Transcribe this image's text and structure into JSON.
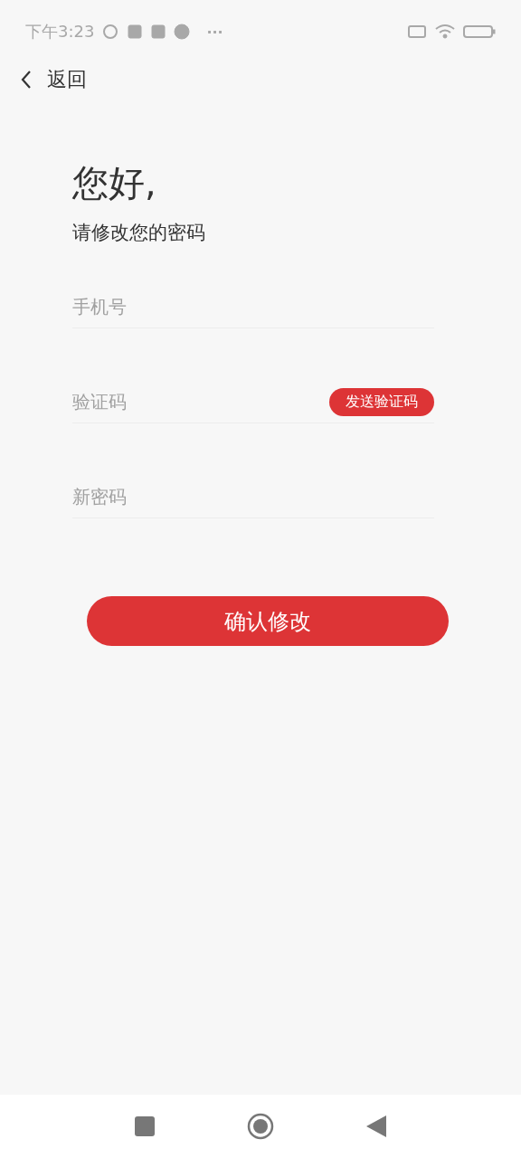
{
  "status_bar": {
    "time": "下午3:23",
    "more": "···"
  },
  "nav": {
    "back_label": "返回"
  },
  "greeting": "您好,",
  "subtitle": "请修改您的密码",
  "fields": [
    {
      "kind": "plain",
      "placeholder": "手机号"
    },
    {
      "kind": "code",
      "placeholder": "验证码",
      "button": "发送验证码"
    },
    {
      "kind": "plain",
      "placeholder": "新密码"
    }
  ],
  "submit": "确认修改"
}
